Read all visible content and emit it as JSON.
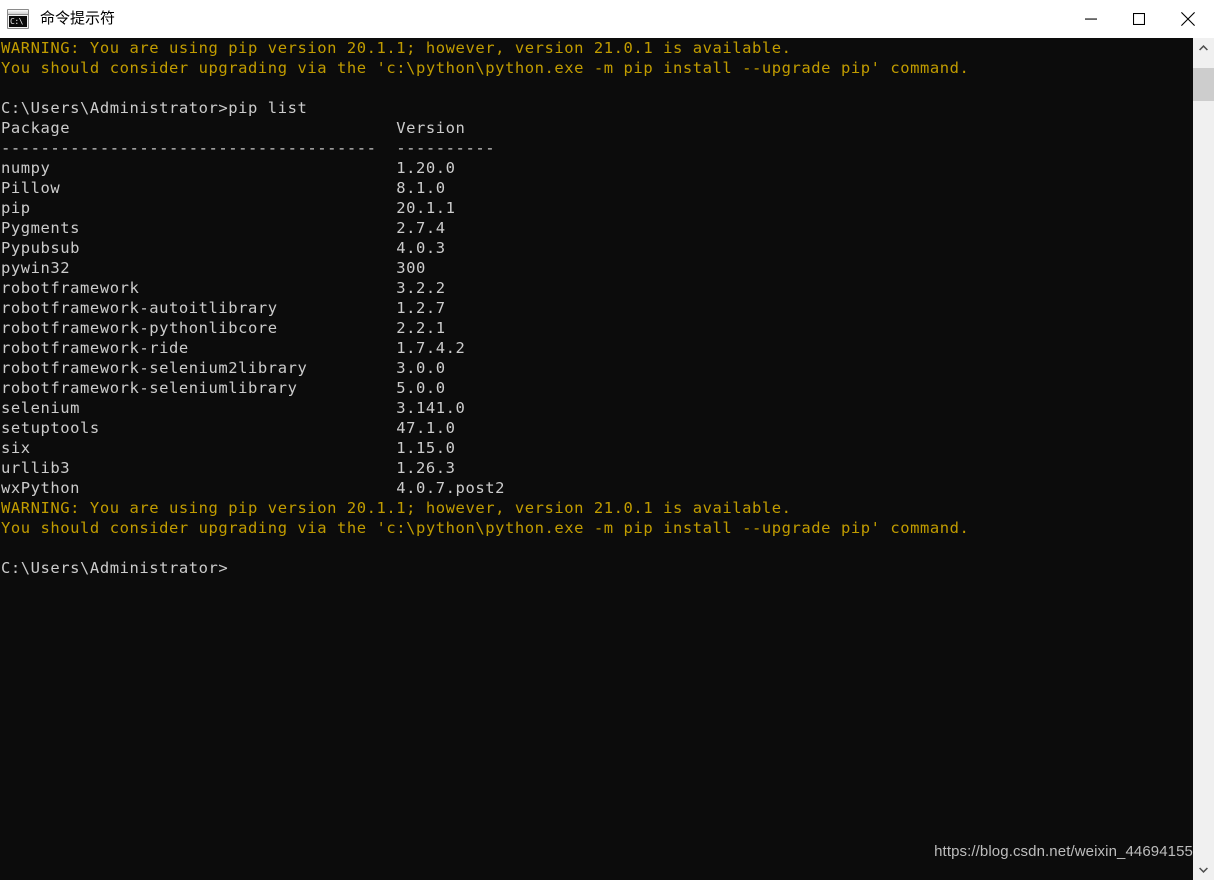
{
  "window": {
    "title": "命令提示符",
    "icon_name": "cmd-icon",
    "icon_glyph": "C:\\",
    "controls": {
      "minimize_label": "最小化",
      "maximize_label": "最大化",
      "close_label": "关闭"
    }
  },
  "console": {
    "background_color": "#0c0c0c",
    "text_color": "#cccccc",
    "warning_color": "#c19c00",
    "prompt": "C:\\Users\\Administrator>",
    "command": "pip list",
    "columns": {
      "package_header": "Package",
      "version_header": "Version",
      "package_rule": "--------------------------------------",
      "version_rule": "----------"
    },
    "warning_block": [
      "WARNING: You are using pip version 20.1.1; however, version 21.0.1 is available.",
      "You should consider upgrading via the 'c:\\python\\python.exe -m pip install --upgrade pip' command."
    ],
    "packages": [
      {
        "name": "numpy",
        "version": "1.20.0"
      },
      {
        "name": "Pillow",
        "version": "8.1.0"
      },
      {
        "name": "pip",
        "version": "20.1.1"
      },
      {
        "name": "Pygments",
        "version": "2.7.4"
      },
      {
        "name": "Pypubsub",
        "version": "4.0.3"
      },
      {
        "name": "pywin32",
        "version": "300"
      },
      {
        "name": "robotframework",
        "version": "3.2.2"
      },
      {
        "name": "robotframework-autoitlibrary",
        "version": "1.2.7"
      },
      {
        "name": "robotframework-pythonlibcore",
        "version": "2.2.1"
      },
      {
        "name": "robotframework-ride",
        "version": "1.7.4.2"
      },
      {
        "name": "robotframework-selenium2library",
        "version": "3.0.0"
      },
      {
        "name": "robotframework-seleniumlibrary",
        "version": "5.0.0"
      },
      {
        "name": "selenium",
        "version": "3.141.0"
      },
      {
        "name": "setuptools",
        "version": "47.1.0"
      },
      {
        "name": "six",
        "version": "1.15.0"
      },
      {
        "name": "urllib3",
        "version": "1.26.3"
      },
      {
        "name": "wxPython",
        "version": "4.0.7.post2"
      }
    ],
    "final_prompt": "C:\\Users\\Administrator>"
  },
  "watermark": {
    "text": "https://blog.csdn.net/weixin_44694155"
  },
  "scrollbar": {
    "up_label": "向上滚动",
    "down_label": "向下滚动",
    "thumb_label": "滚动条滑块"
  }
}
